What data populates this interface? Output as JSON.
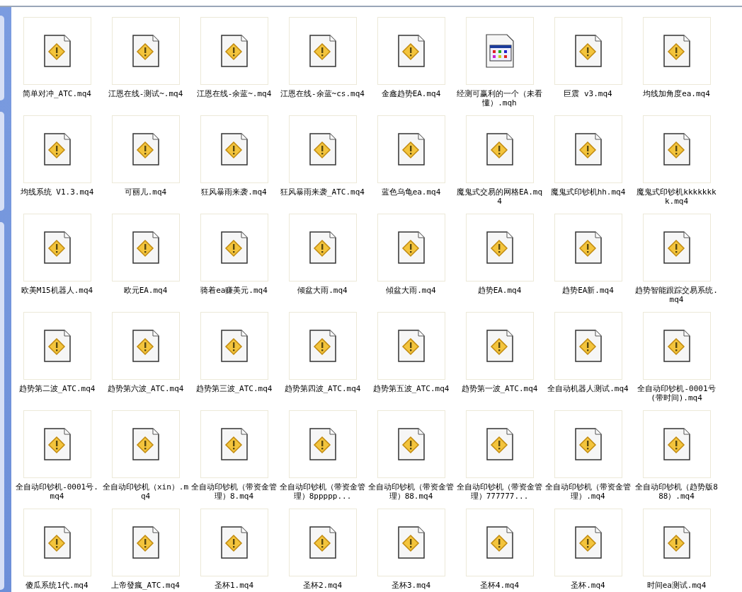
{
  "files": [
    {
      "name": "简单对冲_ATC.mq4",
      "kind": "warning"
    },
    {
      "name": "江恩在线-测试~.mq4",
      "kind": "warning"
    },
    {
      "name": "江恩在线-余蓝~.mq4",
      "kind": "warning"
    },
    {
      "name": "江恩在线-余蓝~cs.mq4",
      "kind": "warning"
    },
    {
      "name": "金鑫趋势EA.mq4",
      "kind": "warning"
    },
    {
      "name": "经测可赢利的一个（未看懂）.mqh",
      "kind": "app"
    },
    {
      "name": "巨震 v3.mq4",
      "kind": "warning"
    },
    {
      "name": "均线加角度ea.mq4",
      "kind": "warning"
    },
    {
      "name": "均线系统 V1.3.mq4",
      "kind": "warning"
    },
    {
      "name": "可丽儿.mq4",
      "kind": "warning"
    },
    {
      "name": "狂风暴雨来袭.mq4",
      "kind": "warning"
    },
    {
      "name": "狂风暴雨来袭_ATC.mq4",
      "kind": "warning"
    },
    {
      "name": "蓝色乌龟ea.mq4",
      "kind": "warning"
    },
    {
      "name": "魔鬼式交易的网格EA.mq4",
      "kind": "warning"
    },
    {
      "name": "魔鬼式印钞机hh.mq4",
      "kind": "warning"
    },
    {
      "name": "魔鬼式印钞机kkkkkkkk.mq4",
      "kind": "warning"
    },
    {
      "name": "欧美M15机器人.mq4",
      "kind": "warning"
    },
    {
      "name": "欧元EA.mq4",
      "kind": "warning"
    },
    {
      "name": "骑着ea赚美元.mq4",
      "kind": "warning"
    },
    {
      "name": "倾盆大雨.mq4",
      "kind": "warning"
    },
    {
      "name": "傾盆大雨.mq4",
      "kind": "warning"
    },
    {
      "name": "趋势EA.mq4",
      "kind": "warning"
    },
    {
      "name": "趋势EA新.mq4",
      "kind": "warning"
    },
    {
      "name": "趋势智能跟踪交易系统.mq4",
      "kind": "warning"
    },
    {
      "name": "趋势第二波_ATC.mq4",
      "kind": "warning"
    },
    {
      "name": "趋势第六波_ATC.mq4",
      "kind": "warning"
    },
    {
      "name": "趋势第三波_ATC.mq4",
      "kind": "warning"
    },
    {
      "name": "趋势第四波_ATC.mq4",
      "kind": "warning"
    },
    {
      "name": "趋势第五波_ATC.mq4",
      "kind": "warning"
    },
    {
      "name": "趋势第一波_ATC.mq4",
      "kind": "warning"
    },
    {
      "name": "全自动机器人测试.mq4",
      "kind": "warning"
    },
    {
      "name": "全自动印钞机-0001号(带时间).mq4",
      "kind": "warning"
    },
    {
      "name": "全自动印钞机-0001号.mq4",
      "kind": "warning"
    },
    {
      "name": "全自动印钞机（xin）.mq4",
      "kind": "warning"
    },
    {
      "name": "全自动印钞机（带资金管理）8.mq4",
      "kind": "warning"
    },
    {
      "name": "全自动印钞机（带资金管理）8ppppp...",
      "kind": "warning"
    },
    {
      "name": "全自动印钞机（带资金管理）88.mq4",
      "kind": "warning"
    },
    {
      "name": "全自动印钞机（带资金管理）777777...",
      "kind": "warning"
    },
    {
      "name": "全自动印钞机（带资金管理）.mq4",
      "kind": "warning"
    },
    {
      "name": "全自动印钞机（趋势版888）.mq4",
      "kind": "warning"
    },
    {
      "name": "傻瓜系统1代.mq4",
      "kind": "warning"
    },
    {
      "name": "上帝發瘋_ATC.mq4",
      "kind": "warning"
    },
    {
      "name": "圣杯1.mq4",
      "kind": "warning"
    },
    {
      "name": "圣杯2.mq4",
      "kind": "warning"
    },
    {
      "name": "圣杯3.mq4",
      "kind": "warning"
    },
    {
      "name": "圣杯4.mq4",
      "kind": "warning"
    },
    {
      "name": "圣杯.mq4",
      "kind": "warning"
    },
    {
      "name": "时间ea测试.mq4",
      "kind": "warning"
    }
  ]
}
